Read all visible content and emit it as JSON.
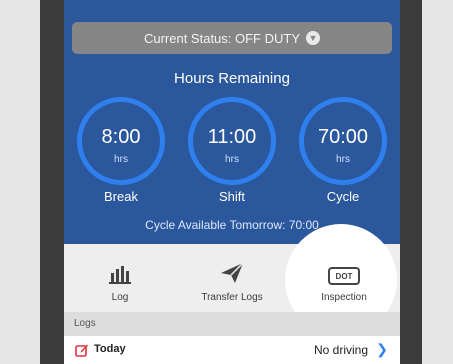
{
  "status": {
    "text": "Current Status: OFF DUTY"
  },
  "hours": {
    "title": "Hours Remaining",
    "gauges": [
      {
        "value": "8:00",
        "unit": "hrs",
        "label": "Break"
      },
      {
        "value": "11:00",
        "unit": "hrs",
        "label": "Shift"
      },
      {
        "value": "70:00",
        "unit": "hrs",
        "label": "Cycle"
      }
    ],
    "cycle_available": "Cycle Available Tomorrow: 70:00"
  },
  "actions": [
    {
      "label": "Log",
      "icon": "bar-chart-icon"
    },
    {
      "label": "Transfer Logs",
      "icon": "paper-plane-icon"
    },
    {
      "label": "Inspection",
      "icon": "dot-badge-icon",
      "badge": "DOT"
    }
  ],
  "logs": {
    "header": "Logs",
    "today_label": "Today",
    "today_value": "No driving"
  },
  "colors": {
    "dashboard_bg": "#2b579c",
    "ring": "#2f80ee",
    "status_bg": "#868686",
    "accent_red": "#e0323a",
    "link_blue": "#2f80ee"
  }
}
